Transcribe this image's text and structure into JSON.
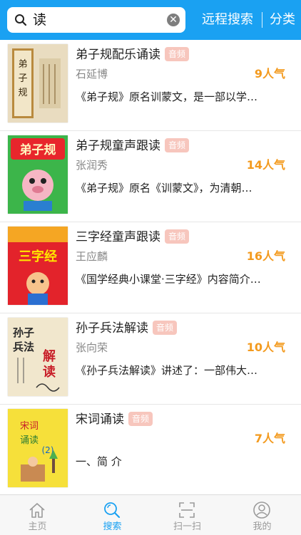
{
  "search": {
    "query": "读",
    "remote_label": "远程搜索",
    "category_label": "分类"
  },
  "results": [
    {
      "title": "弟子规配乐诵读",
      "tag": "音频",
      "author": "石延博",
      "popularity": "9人气",
      "desc": "《弟子规》原名训蒙文，是一部以学…",
      "cover_text": "弟子规"
    },
    {
      "title": "弟子规童声跟读",
      "tag": "音频",
      "author": "张润秀",
      "popularity": "14人气",
      "desc": "《弟子规》原名《训蒙文》，为清朝…",
      "cover_text": "弟子规"
    },
    {
      "title": "三字经童声跟读",
      "tag": "音频",
      "author": "王应麟",
      "popularity": "16人气",
      "desc": "《国学经典小课堂·三字经》内容简介…",
      "cover_text": "三字经"
    },
    {
      "title": "孙子兵法解读",
      "tag": "音频",
      "author": "张向荣",
      "popularity": "10人气",
      "desc": "《孙子兵法解读》讲述了：一部伟大…",
      "cover_text": "孙子兵法解读"
    },
    {
      "title": "宋词诵读",
      "tag": "音频",
      "author": "",
      "popularity": "7人气",
      "desc": "一、简 介",
      "cover_text": "宋词诵读"
    }
  ],
  "tabs": [
    {
      "label": "主页",
      "icon": "home-icon"
    },
    {
      "label": "搜索",
      "icon": "search-icon",
      "active": true
    },
    {
      "label": "扫一扫",
      "icon": "scan-icon"
    },
    {
      "label": "我的",
      "icon": "profile-icon"
    }
  ],
  "colors": {
    "accent": "#1aa1f2",
    "popularity": "#f39a1e",
    "tag_bg": "#f7c6bd"
  }
}
